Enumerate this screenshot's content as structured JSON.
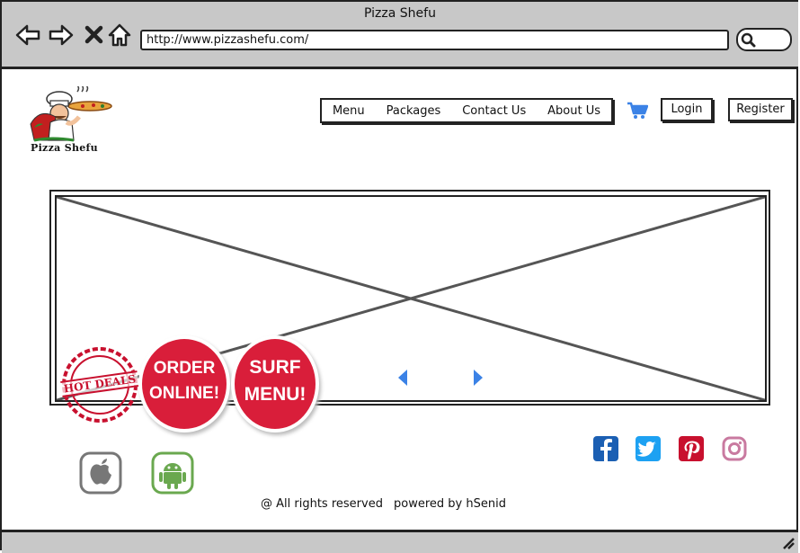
{
  "window": {
    "title": "Pizza Shefu"
  },
  "browser": {
    "url": "http://www.pizzashefu.com/"
  },
  "logo": {
    "text": "Pizza Shefu"
  },
  "nav": {
    "items": [
      "Menu",
      "Packages",
      "Contact Us",
      "About Us"
    ]
  },
  "auth": {
    "login": "Login",
    "register": "Register"
  },
  "badges": {
    "hot_deals": "HOT DEALS",
    "order_online_1": "ORDER",
    "order_online_2": "ONLINE!",
    "surf_menu_1": "SURF",
    "surf_menu_2": "MENU!"
  },
  "footer": {
    "rights": "@ All rights reserved",
    "powered": "powered by hSenid"
  },
  "colors": {
    "accent": "#3b82e6",
    "badge_red": "#d91e3a",
    "android": "#6aa84f",
    "facebook": "#1b5fb3",
    "twitter": "#1da1f2",
    "pinterest": "#c8102e",
    "instagram": "#c97aa0"
  }
}
